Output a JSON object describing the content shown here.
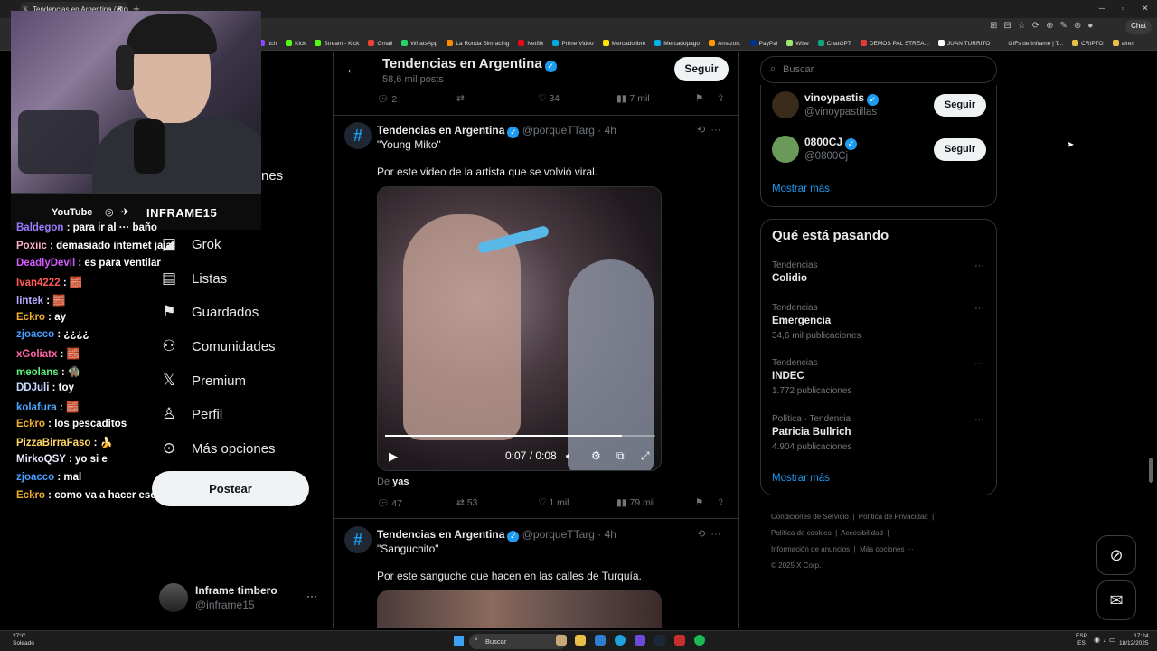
{
  "browser": {
    "tab_title": "Tendencias en Argentina (@porq",
    "new_tab": "+",
    "chat_label": "Chat",
    "bookmarks": [
      "itch",
      "Kick",
      "Stream - Kick",
      "Gmail",
      "WhatsApp",
      "La Ronda Simracing",
      "Netflix",
      "Prime Video",
      "Mercadolibre",
      "Mercadopago",
      "Amazon.",
      "PayPal",
      "Wise",
      "ChatGPT",
      "DEMOS PAL STREA...",
      "JUAN TURRITO",
      "GIFs de Inframe | T...",
      "CRIPTO",
      "aires"
    ]
  },
  "overlay": {
    "youtube": "YouTube",
    "channel": "INFRAME15",
    "partial_nav_text": "nes"
  },
  "chat": [
    {
      "user": "Baldegon",
      "msg": ": para ir al ··· baño",
      "color": "#9a7cff"
    },
    {
      "user": "Poxiic",
      "msg": ": demasiado internet jaja",
      "color": "#ffb0c8"
    },
    {
      "user": "DeadlyDevil",
      "msg": ": es para ventilar",
      "color": "#d45cff"
    },
    {
      "user": "Ivan4222",
      "msg": ": 🧱",
      "color": "#ff5a5a"
    },
    {
      "user": "lintek",
      "msg": ": 🧱",
      "color": "#b8a8ff"
    },
    {
      "user": "Eckro",
      "msg": ": ay",
      "color": "#f0b030"
    },
    {
      "user": "zjoacco",
      "msg": ": ¿¿¿¿",
      "color": "#4a9cff"
    },
    {
      "user": "xGoliatx",
      "msg": ": 🧱",
      "color": "#ff66a8"
    },
    {
      "user": "meolans",
      "msg": ": 🧌",
      "color": "#5ef07a"
    },
    {
      "user": "DDJuli",
      "msg": ": toy",
      "color": "#c8d8ff"
    },
    {
      "user": "kolafura",
      "msg": ": 🧱",
      "color": "#4aa8ff"
    },
    {
      "user": "Eckro",
      "msg": ": los pescaditos",
      "color": "#f0b030"
    },
    {
      "user": "PizzaBirraFaso",
      "msg": ": 🍌",
      "color": "#ffd866"
    },
    {
      "user": "MirkoQSY",
      "msg": ": yo si e",
      "color": "#e8e8ff"
    },
    {
      "user": "zjoacco",
      "msg": ": mal",
      "color": "#4a9cff"
    },
    {
      "user": "Eckro",
      "msg": ": como va a hacer eso el loco",
      "color": "#f0b030"
    }
  ],
  "nav": {
    "items": [
      "Grok",
      "Listas",
      "Guardados",
      "Comunidades",
      "Premium",
      "Perfil",
      "Más opciones"
    ],
    "icons": [
      "grok-icon",
      "list-icon",
      "bookmark-icon",
      "communities-icon",
      "x-logo-icon",
      "person-icon",
      "more-circle-icon"
    ],
    "post_button": "Postear",
    "profile_name": "Inframe timbero",
    "profile_handle": "@inframe15",
    "profile_more": "···"
  },
  "header": {
    "title": "Tendencias en Argentina",
    "subtitle": "58,6 mil posts",
    "follow": "Seguir"
  },
  "top_actions": {
    "replies": "2",
    "likes": "34",
    "views": "7 mil"
  },
  "posts": [
    {
      "author": "Tendencias en Argentina",
      "meta": "@porqueTTarg · 4h",
      "quote": "\"Young Miko\"",
      "text": "Por este video de la artista que se volvió viral.",
      "video": {
        "time": "0:07 / 0:08",
        "progress": 0.875
      },
      "from_label": "De",
      "from_user": "yas",
      "replies": "47",
      "reposts": "53",
      "likes": "1 mil",
      "views": "79 mil"
    },
    {
      "author": "Tendencias en Argentina",
      "meta": "@porqueTTarg · 4h",
      "quote": "\"Sanguchito\"",
      "text": "Por este sanguche que hacen en las calles de Turquía."
    }
  ],
  "search": {
    "placeholder": "Buscar"
  },
  "who_to_follow": [
    {
      "name": "vinoypastis",
      "handle": "@vinoypastillas",
      "follow": "Seguir",
      "avatar_color": "#3a2a1a"
    },
    {
      "name": "0800CJ",
      "handle": "@0800Cj",
      "follow": "Seguir",
      "avatar_color": "#6a9a5a"
    }
  ],
  "show_more": "Mostrar más",
  "trending": {
    "title": "Qué está pasando",
    "items": [
      {
        "category": "Tendencias",
        "name": "Colidio",
        "count": ""
      },
      {
        "category": "Tendencias",
        "name": "Emergencia",
        "count": "34,6 mil publicaciones"
      },
      {
        "category": "Tendencias",
        "name": "INDEC",
        "count": "1.772 publicaciones"
      },
      {
        "category": "Política · Tendencia",
        "name": "Patricia Bullrich",
        "count": "4.904 publicaciones"
      }
    ],
    "show_more": "Mostrar más"
  },
  "footer": {
    "links": [
      "Condiciones de Servicio",
      "Política de Privacidad",
      "Política de cookies",
      "Accesibilidad",
      "Información de anuncios",
      "Más opciones ···"
    ],
    "copyright": "© 2025 X Corp."
  },
  "taskbar": {
    "temp": "27°C",
    "weather": "Soleado",
    "search": "Buscar",
    "lang1": "ESP",
    "lang2": "ES",
    "time": "17:24",
    "date": "18/12/2025"
  },
  "colors": {
    "accent": "#1d9bf0",
    "background": "#000000",
    "muted": "#71767b"
  }
}
